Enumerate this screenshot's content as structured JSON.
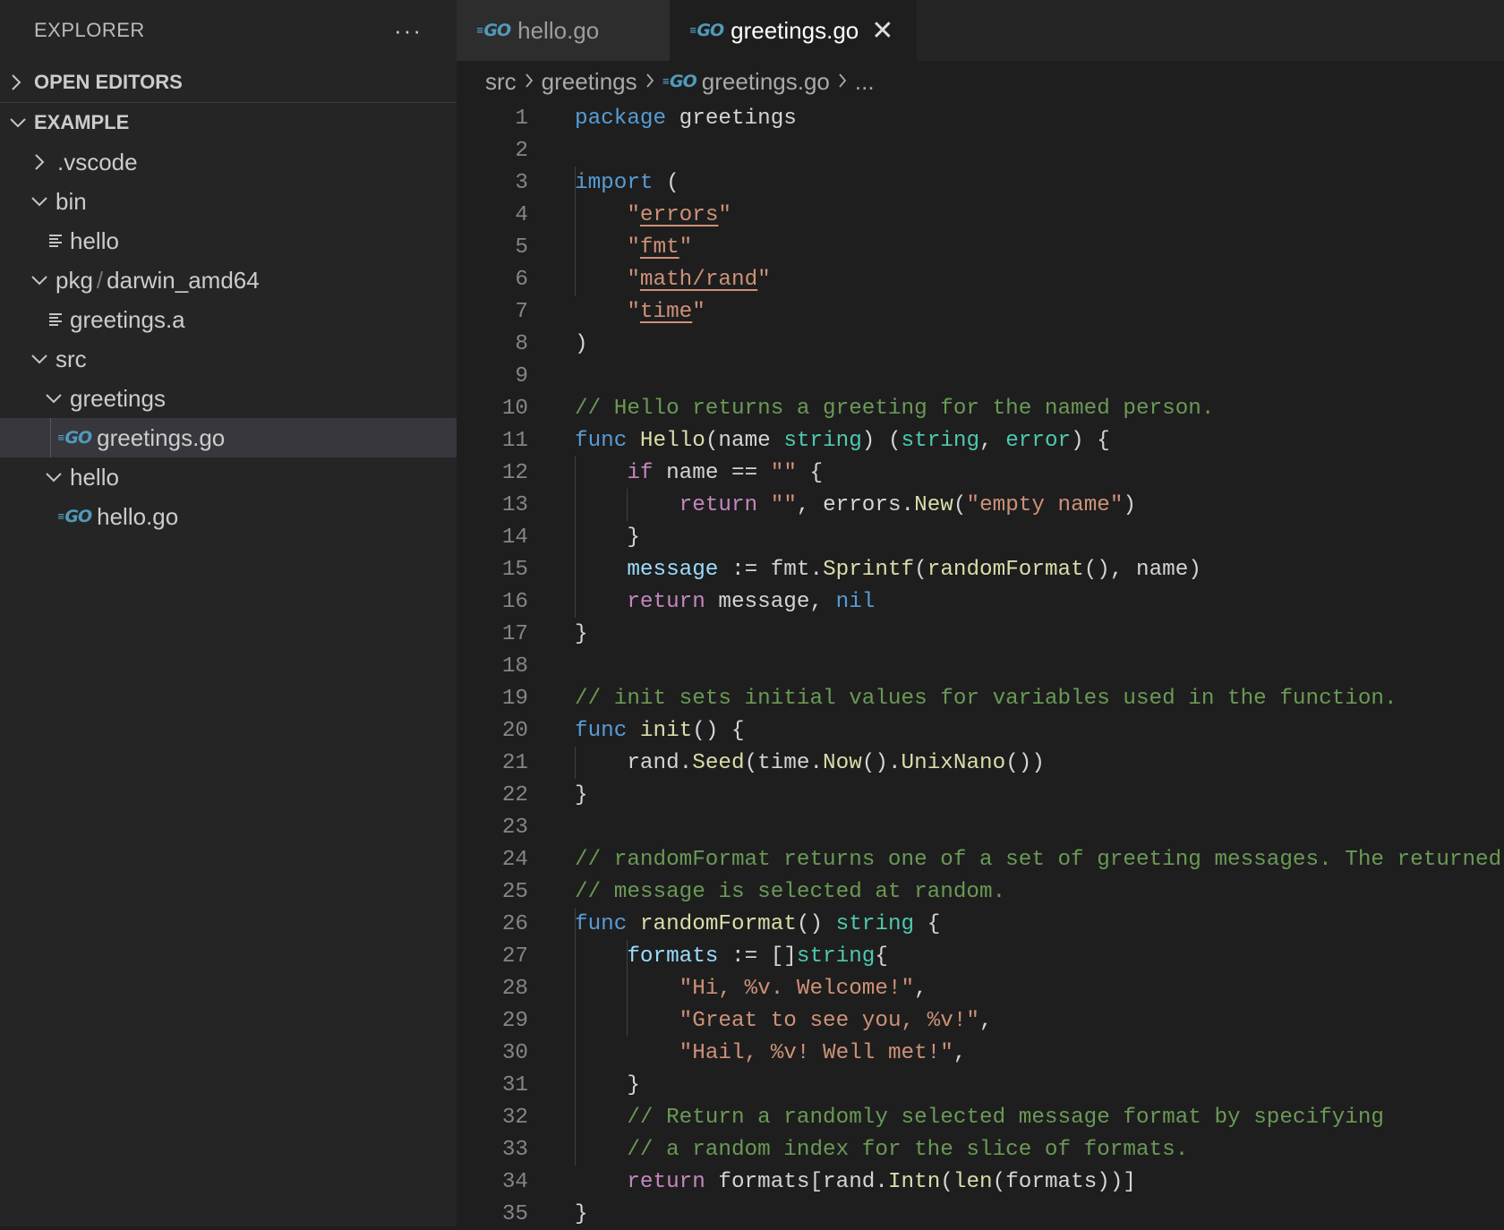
{
  "sidebar": {
    "title": "EXPLORER",
    "more": "···",
    "sections": {
      "open_editors": "OPEN EDITORS",
      "workspace": "EXAMPLE"
    },
    "tree": [
      {
        "label": ".vscode",
        "kind": "folder-collapsed",
        "depth": 1
      },
      {
        "label": "bin",
        "kind": "folder-open",
        "depth": 1
      },
      {
        "label": "hello",
        "kind": "file",
        "depth": 2
      },
      {
        "label": "pkg",
        "label2": "darwin_amd64",
        "kind": "folder-open",
        "depth": 1
      },
      {
        "label": "greetings.a",
        "kind": "file",
        "depth": 2
      },
      {
        "label": "src",
        "kind": "folder-open",
        "depth": 1
      },
      {
        "label": "greetings",
        "kind": "folder-open",
        "depth": 2
      },
      {
        "label": "greetings.go",
        "kind": "go",
        "depth": 3,
        "selected": true
      },
      {
        "label": "hello",
        "kind": "folder-open",
        "depth": 2
      },
      {
        "label": "hello.go",
        "kind": "go",
        "depth": 3
      }
    ]
  },
  "tabs": [
    {
      "label": "hello.go",
      "active": false
    },
    {
      "label": "greetings.go",
      "active": true
    }
  ],
  "breadcrumb": {
    "parts": [
      "src",
      "greetings",
      "greetings.go",
      "..."
    ]
  },
  "go_icon_text": "GO",
  "close_glyph": "✕",
  "code": {
    "lines": [
      "1",
      "2",
      "3",
      "4",
      "5",
      "6",
      "7",
      "8",
      "9",
      "10",
      "11",
      "12",
      "13",
      "14",
      "15",
      "16",
      "17",
      "18",
      "19",
      "20",
      "21",
      "22",
      "23",
      "24",
      "25",
      "26",
      "27",
      "28",
      "29",
      "30",
      "31",
      "32",
      "33",
      "34",
      "35"
    ],
    "comments": {
      "c10": "// Hello returns a greeting for the named person.",
      "c19": "// init sets initial values for variables used in the function.",
      "c24": "// randomFormat returns one of a set of greeting messages. The returned",
      "c25": "// message is selected at random.",
      "c32": "// Return a randomly selected message format by specifying",
      "c33": "// a random index for the slice of formats."
    },
    "strings": {
      "s28": "\"Hi, %v. Welcome!\"",
      "s29": "\"Great to see you, %v!\"",
      "s30": "\"Hail, %v! Well met!\"",
      "empty_name": "\"empty name\""
    }
  }
}
